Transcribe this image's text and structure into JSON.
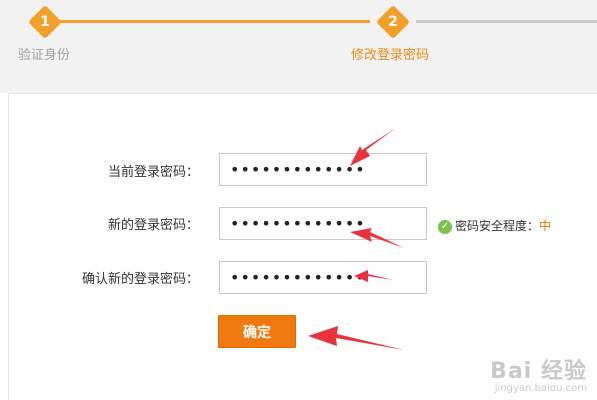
{
  "steps": [
    {
      "number": "1",
      "label": "验证身份"
    },
    {
      "number": "2",
      "label": "修改登录密码"
    }
  ],
  "form": {
    "current_password": {
      "label": "当前登录密码：",
      "value": "•••••••••••••"
    },
    "new_password": {
      "label": "新的登录密码：",
      "value": "•••••••••••••"
    },
    "confirm_password": {
      "label": "确认新的登录密码：",
      "value": "•••••••••••••"
    },
    "strength": {
      "label": "密码安全程度：",
      "level": "中"
    },
    "submit_label": "确定"
  },
  "watermark": {
    "main": "Bai 经验",
    "sub": "jingyan.baidu.com"
  },
  "colors": {
    "accent": "#f3a02b",
    "button": "#f07a10",
    "arrow": "#e8323c",
    "check": "#7cc24b"
  }
}
